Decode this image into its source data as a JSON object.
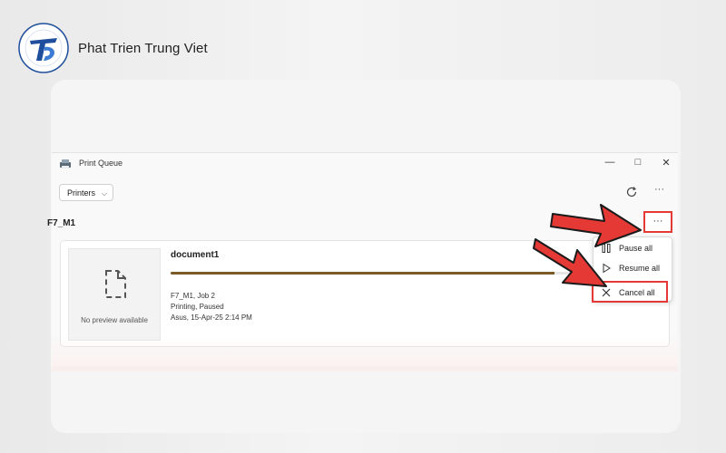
{
  "brand": {
    "name": "Phat Trien Trung Viet",
    "logo_icon": "ttv-logo-icon"
  },
  "window": {
    "title": "Print Queue",
    "controls": {
      "minimize": "—",
      "maximize": "□",
      "close": "✕"
    }
  },
  "toolbar": {
    "printers_label": "Printers",
    "refresh_icon": "refresh-icon",
    "more_label": "···"
  },
  "printer": {
    "name": "F7_M1",
    "more_label": "···"
  },
  "job": {
    "document": "document1",
    "preview_text": "No preview available",
    "progress": 0.9,
    "line1": "F7_M1, Job 2",
    "line2": "Printing, Paused",
    "line3": "Asus, 15-Apr-25 2:14 PM"
  },
  "menu": {
    "items": [
      {
        "label": "Pause all",
        "icon": "pause-icon"
      },
      {
        "label": "Resume all",
        "icon": "play-icon"
      },
      {
        "label": "Cancel all",
        "icon": "close-icon"
      }
    ]
  },
  "colors": {
    "highlight": "#e53935",
    "progress": "#7a5b25",
    "brand": "#1f4e9c"
  }
}
